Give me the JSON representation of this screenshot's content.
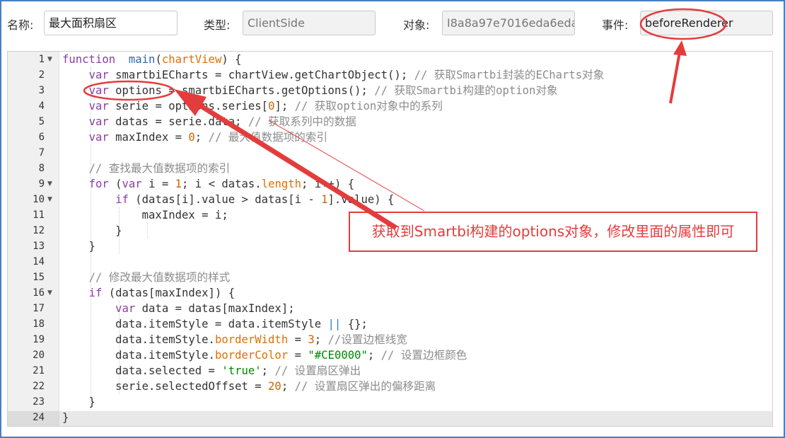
{
  "form": {
    "name_label": "名称:",
    "name_value": "最大面积扇区",
    "type_label": "类型:",
    "type_value": "ClientSide",
    "object_label": "对象:",
    "object_value": "I8a8a97e7016eda6eda",
    "event_label": "事件:",
    "event_value": "beforeRenderer"
  },
  "editor": {
    "lines": [
      {
        "n": "1",
        "fold": true,
        "tokens": [
          [
            "k",
            "function"
          ],
          [
            "",
            "  "
          ],
          [
            "f",
            "main"
          ],
          [
            "",
            "("
          ],
          [
            "p",
            "chartView"
          ],
          [
            "",
            ") {"
          ]
        ]
      },
      {
        "n": "2",
        "fold": false,
        "tokens": [
          [
            "",
            "    "
          ],
          [
            "k",
            "var"
          ],
          [
            "",
            " smartbiECharts = chartView.getChartObject(); "
          ],
          [
            "c",
            "// 获取Smartbi封装的ECharts对象"
          ]
        ]
      },
      {
        "n": "3",
        "fold": false,
        "tokens": [
          [
            "",
            "    "
          ],
          [
            "k",
            "var"
          ],
          [
            "",
            " options = smartbiECharts.getOptions(); "
          ],
          [
            "c",
            "// 获取Smartbi构建的option对象"
          ]
        ]
      },
      {
        "n": "4",
        "fold": false,
        "tokens": [
          [
            "",
            "    "
          ],
          [
            "k",
            "var"
          ],
          [
            "",
            " serie = options.series["
          ],
          [
            "n",
            "0"
          ],
          [
            "",
            "]; "
          ],
          [
            "c",
            "// 获取option对象中的系列"
          ]
        ]
      },
      {
        "n": "5",
        "fold": false,
        "tokens": [
          [
            "",
            "    "
          ],
          [
            "k",
            "var"
          ],
          [
            "",
            " datas = serie.data; "
          ],
          [
            "c",
            "// 获取系列中的数据"
          ]
        ]
      },
      {
        "n": "6",
        "fold": false,
        "tokens": [
          [
            "",
            "    "
          ],
          [
            "k",
            "var"
          ],
          [
            "",
            " maxIndex = "
          ],
          [
            "n",
            "0"
          ],
          [
            "",
            "; "
          ],
          [
            "c",
            "// 最大值数据项的索引"
          ]
        ]
      },
      {
        "n": "7",
        "fold": false,
        "tokens": []
      },
      {
        "n": "8",
        "fold": false,
        "tokens": [
          [
            "",
            "    "
          ],
          [
            "c",
            "// 查找最大值数据项的索引"
          ]
        ]
      },
      {
        "n": "9",
        "fold": true,
        "tokens": [
          [
            "",
            "    "
          ],
          [
            "k",
            "for"
          ],
          [
            "",
            " ("
          ],
          [
            "k",
            "var"
          ],
          [
            "",
            " i = "
          ],
          [
            "n",
            "1"
          ],
          [
            "",
            "; i < datas."
          ],
          [
            "p",
            "length"
          ],
          [
            "",
            "; i++) {"
          ]
        ]
      },
      {
        "n": "10",
        "fold": true,
        "tokens": [
          [
            "",
            "        "
          ],
          [
            "k",
            "if"
          ],
          [
            "",
            " (datas[i].value > datas[i - "
          ],
          [
            "n",
            "1"
          ],
          [
            "",
            "].value) {"
          ]
        ]
      },
      {
        "n": "11",
        "fold": false,
        "tokens": [
          [
            "",
            "            maxIndex = i;"
          ]
        ]
      },
      {
        "n": "12",
        "fold": false,
        "tokens": [
          [
            "",
            "        }"
          ]
        ]
      },
      {
        "n": "13",
        "fold": false,
        "tokens": [
          [
            "",
            "    }"
          ]
        ]
      },
      {
        "n": "14",
        "fold": false,
        "tokens": []
      },
      {
        "n": "15",
        "fold": false,
        "tokens": [
          [
            "",
            "    "
          ],
          [
            "c",
            "// 修改最大值数据项的样式"
          ]
        ]
      },
      {
        "n": "16",
        "fold": true,
        "tokens": [
          [
            "",
            "    "
          ],
          [
            "k",
            "if"
          ],
          [
            "",
            " (datas[maxIndex]) {"
          ]
        ]
      },
      {
        "n": "17",
        "fold": false,
        "tokens": [
          [
            "",
            "        "
          ],
          [
            "k",
            "var"
          ],
          [
            "",
            " data = datas[maxIndex];"
          ]
        ]
      },
      {
        "n": "18",
        "fold": false,
        "tokens": [
          [
            "",
            "        data.itemStyle = data.itemStyle "
          ],
          [
            "o",
            "||"
          ],
          [
            "",
            " {};"
          ]
        ]
      },
      {
        "n": "19",
        "fold": false,
        "tokens": [
          [
            "",
            "        data.itemStyle."
          ],
          [
            "p",
            "borderWidth"
          ],
          [
            "",
            " = "
          ],
          [
            "n",
            "3"
          ],
          [
            "",
            "; "
          ],
          [
            "c",
            "//设置边框线宽"
          ]
        ]
      },
      {
        "n": "20",
        "fold": false,
        "tokens": [
          [
            "",
            "        data.itemStyle."
          ],
          [
            "p",
            "borderColor"
          ],
          [
            "",
            " = "
          ],
          [
            "s",
            "\"#CE0000\""
          ],
          [
            "",
            "; "
          ],
          [
            "c",
            "// 设置边框颜色"
          ]
        ]
      },
      {
        "n": "21",
        "fold": false,
        "tokens": [
          [
            "",
            "        data.selected = "
          ],
          [
            "s",
            "'true'"
          ],
          [
            "",
            "; "
          ],
          [
            "c",
            "// 设置扇区弹出"
          ]
        ]
      },
      {
        "n": "22",
        "fold": false,
        "tokens": [
          [
            "",
            "        serie.selectedOffset = "
          ],
          [
            "n",
            "20"
          ],
          [
            "",
            "; "
          ],
          [
            "c",
            "// 设置扇区弹出的偏移距离"
          ]
        ]
      },
      {
        "n": "23",
        "fold": false,
        "tokens": [
          [
            "",
            "    }"
          ]
        ]
      },
      {
        "n": "24",
        "fold": false,
        "tokens": [
          [
            "",
            "}"
          ]
        ]
      }
    ]
  },
  "annotation": {
    "callout_text": "获取到Smartbi构建的options对象，修改里面的属性即可",
    "color": "#e43c3c"
  }
}
